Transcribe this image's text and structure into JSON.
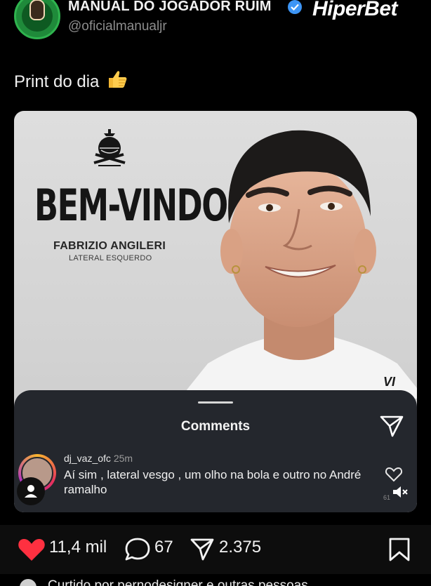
{
  "post": {
    "account_name": "MANUAL DO JOGADOR RUIM",
    "handle": "@oficialmanualjr",
    "brand_logo_text": "HiperBet",
    "caption": "Print do dia",
    "caption_emoji": "thumbs-up"
  },
  "image": {
    "headline": "BEM-VINDO",
    "player_name": "FABRIZIO ANGILERI",
    "player_role": "LATERAL ESQUERDO",
    "shirt_text": "VI"
  },
  "comments_sheet": {
    "title": "Comments",
    "comment": {
      "username": "dj_vaz_ofc",
      "time": "25m",
      "text": "Aí sim , lateral vesgo , um olho na bola e outro no André ramalho",
      "like_count": "61"
    }
  },
  "actions": {
    "likes": "11,4 mil",
    "comments": "67",
    "shares": "2.375"
  },
  "liked_by": "Curtido por pernodesigner e outras pessoas",
  "colors": {
    "background": "#000000",
    "verified": "#3d95f5",
    "like_red": "#ff3040",
    "sheet": "#24272d"
  }
}
